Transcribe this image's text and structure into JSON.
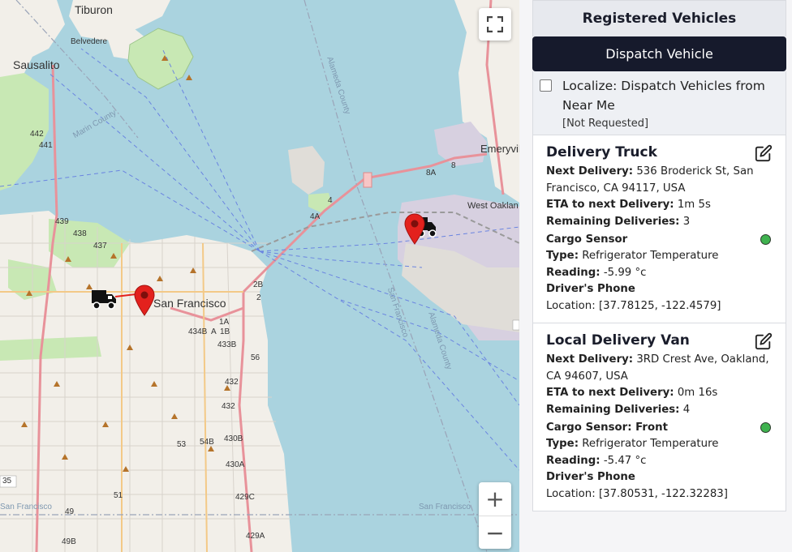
{
  "map": {
    "labels": {
      "tiburon": "Tiburon",
      "belvedere": "Belvedere",
      "sausalito": "Sausalito",
      "marin_county": "Marin County",
      "alameda_county": "Alameda County",
      "emeryville": "Emeryville",
      "west_oakland": "West Oaklan",
      "san_francisco": "San Francisco",
      "sf_water": "San Francisco",
      "alameda_county_water": "Alameda County",
      "san_francisco_lower": "San Francisco",
      "route_442": "442",
      "route_441": "441",
      "route_439": "439",
      "route_438": "438",
      "route_437": "437",
      "route_8a": "8A",
      "route_8": "8",
      "route_4": "4",
      "route_4a": "4A",
      "route_2b": "2B",
      "route_2": "2",
      "route_434b": "434B",
      "route_434a": "A",
      "route_1b": "1B",
      "route_1a": "1A",
      "route_433b": "433B",
      "route_56": "56",
      "route_432": "432",
      "route_35": "35",
      "route_430b": "430B",
      "route_430a": "430A",
      "route_429c": "429C",
      "route_429a": "429A",
      "route_54b": "54B",
      "route_49b": "49B",
      "route_49": "49",
      "route_51": "51",
      "route_53": "53",
      "e_edge": "E"
    },
    "fullscreen_icon": "fullscreen-icon",
    "zoom_in": "+",
    "zoom_out": "−",
    "colors": {
      "water": "#aad3df",
      "land": "#f2efe9",
      "park": "#c8e8b4",
      "highway": "#e8929a",
      "marker": "#e3211d",
      "bridge": "#f7c6c6"
    }
  },
  "panel": {
    "header": "Registered Vehicles",
    "dispatch_button": "Dispatch Vehicle",
    "localize_label": "Localize: Dispatch Vehicles from Near Me",
    "localize_status": "[Not Requested]",
    "localize_checked": false,
    "vehicles": [
      {
        "name": "Delivery Truck",
        "next_delivery_label": "Next Delivery:",
        "next_delivery": "536 Broderick St, San Francisco, CA 94117, USA",
        "eta_label": "ETA to next Delivery:",
        "eta": "1m 5s",
        "remaining_label": "Remaining Deliveries:",
        "remaining": "3",
        "sensor_label": "Cargo Sensor",
        "type_label": "Type:",
        "type": "Refrigerator Temperature",
        "reading_label": "Reading:",
        "reading": "-5.99 °c",
        "phone_label": "Driver's Phone",
        "location": "Location: [37.78125, -122.4579]",
        "status_color": "#3fb24f"
      },
      {
        "name": "Local Delivery Van",
        "next_delivery_label": "Next Delivery:",
        "next_delivery": "3RD Crest Ave, Oakland, CA 94607, USA",
        "eta_label": "ETA to next Delivery:",
        "eta": "0m 16s",
        "remaining_label": "Remaining Deliveries:",
        "remaining": "4",
        "sensor_label": "Cargo Sensor: Front",
        "type_label": "Type:",
        "type": "Refrigerator Temperature",
        "reading_label": "Reading:",
        "reading": "-5.47 °c",
        "phone_label": "Driver's Phone",
        "location": "Location: [37.80531, -122.32283]",
        "status_color": "#3fb24f"
      }
    ]
  }
}
